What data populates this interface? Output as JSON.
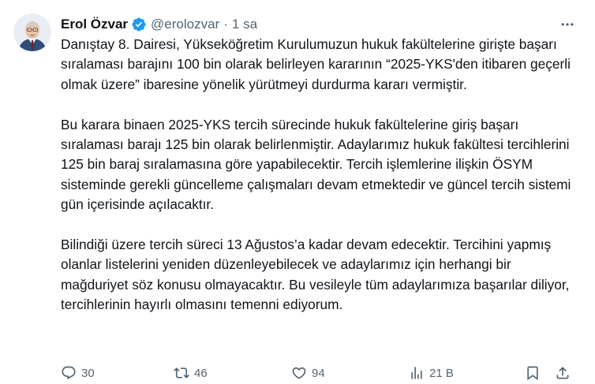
{
  "author": {
    "display_name": "Erol Özvar",
    "handle": "@erolozvar",
    "separator": "·",
    "time": "1 sa",
    "verified": true
  },
  "tweet": {
    "paragraphs": [
      "Danıştay 8. Dairesi, Yükseköğretim Kurulumuzun hukuk fakültelerine girişte başarı sıralaması barajını 100 bin olarak belirleyen kararının “2025-YKS'den itibaren geçerli olmak üzere” ibaresine yönelik yürütmeyi durdurma kararı vermiştir.",
      "Bu karara binaen 2025-YKS tercih sürecinde hukuk fakültelerine giriş başarı sıralaması barajı 125 bin olarak belirlenmiştir. Adaylarımız hukuk fakültesi tercihlerini 125 bin baraj sıralamasına göre yapabilecektir. Tercih işlemlerine ilişkin ÖSYM sisteminde gerekli güncelleme çalışmaları devam etmektedir ve güncel tercih sistemi gün içerisinde açılacaktır.",
      "Bilindiği üzere tercih süreci 13 Ağustos’a kadar devam edecektir. Tercihini yapmış olanlar listelerini yeniden düzenleyebilecek ve adaylarımız için herhangi bir mağduriyet söz konusu olmayacaktır. Bu vesileyle tüm adaylarımıza başarılar diliyor, tercihlerinin hayırlı olmasını temenni ediyorum."
    ]
  },
  "actions": {
    "replies": "30",
    "reposts": "46",
    "likes": "94",
    "views": "21 B"
  },
  "icons": {
    "avatar": "avatar",
    "verified": "verified-badge-icon",
    "more": "more-icon",
    "reply": "reply-icon",
    "repost": "repost-icon",
    "like": "heart-icon",
    "views": "views-icon",
    "bookmark": "bookmark-icon",
    "share": "share-icon"
  },
  "colors": {
    "text": "#0f1419",
    "secondary": "#536471",
    "verified": "#1d9bf0"
  }
}
